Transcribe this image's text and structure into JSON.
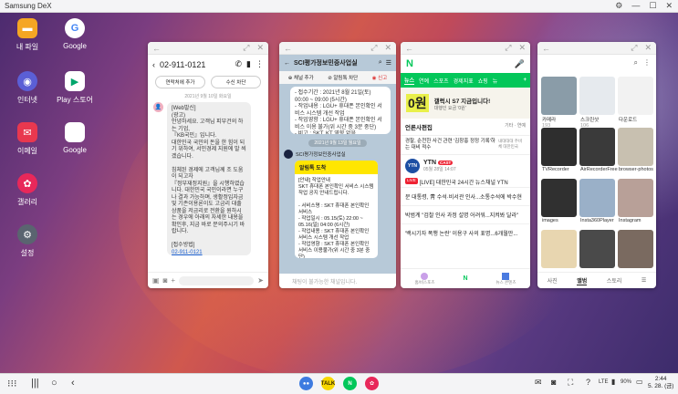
{
  "window_title": "Samsung DeX",
  "desktop_icons": [
    {
      "label": "내 파일",
      "icon": "folder-icon",
      "color": "#f5a623"
    },
    {
      "label": "Google",
      "icon": "google-icon",
      "color": "#ffffff"
    },
    {
      "label": "인터넷",
      "icon": "internet-icon",
      "color": "#5b5fd6"
    },
    {
      "label": "Play 스토어",
      "icon": "play-store-icon",
      "color": "#ffffff"
    },
    {
      "label": "이메일",
      "icon": "email-icon",
      "color": "#e8384f"
    },
    {
      "label": "Google",
      "icon": "google-apps-folder-icon",
      "color": "#ffffff"
    },
    {
      "label": "갤러리",
      "icon": "gallery-icon",
      "color": "#e8285a"
    },
    {
      "label": "설정",
      "icon": "settings-icon",
      "color": "#5a6470"
    }
  ],
  "messages": {
    "phone": "02-911-0121",
    "add_contact": "연락처에 추가",
    "block": "수신 차단",
    "date": "2021년 9월 10일 화요일",
    "sender_tag": "[Web발신]",
    "body": "(광고)\n안녕하세요. 고객님 피부건의 하는 기업,\n『KB국민』입니다.\n대한민국 국민의 돈을 한 힘이 되기 위하여, 서민경제 지원에 발 씌겠습니다.\n\n침체된 경제에 고객님께 조 도움이 되고자\n『정부재정지원』을 시행하였습니다. 대한민국 국민이라면 누구나 결과 가능하며, 생활정입자금 및 기존이용론이도 고금리 대출상품을 저금리로 전환을 원하시는 경우에 아래의 자세한 내용을 확인후, 지금 바로 문의주시기 바랍니다.\n\n[접수방법]",
    "link": "02-911-0121"
  },
  "kakao": {
    "title": "SCI평가정보민중사업실",
    "ch_add": "채널 추가",
    "alarm": "알림톡 차단",
    "report": "신고",
    "date_divider": "2021년 9월 13일 월요일",
    "msg1": "- 접수기간 : 2021년 8월 21일(토) 00:00 ~ 09:00 (5시간)\n- 작업내용 : LGU+ 휴대폰 본인확인 서비스 시스템 개선 작업\n- 작업영향 : LGU+ 휴대폰 본인확인 서비스 이용 불가(위 시간 중 3분 중단)\n- 비고 : SKT, KT 영향 없음",
    "sender": "SCI평가정보민중사업실",
    "card_header": "알림톡 도착",
    "card_body": "[안내] 작업안내\nSKT 휴대폰 본인확인 서비스 시스템 작업 공지 안내드립니다.\n\n- 서비스명 : SKT 휴대폰 본인확인 서비스\n- 작업일시 : 05.15(토) 22:00 ~ 05.16(일) 04:00 (6시간)\n- 작업내용 : SKT 휴대폰 본인확인 서비스 시스템 개선 작업\n- 작업영향 : SKT 휴대폰 본인확인 서비스 이용불가(위 시간 중 3분 중단)\n- 비고 : KT, LGU+ 영향 없음",
    "input_placeholder": "채팅이 불가능한 채널입니다."
  },
  "naver": {
    "tabs": [
      "뉴스",
      "연예",
      "스포츠",
      "경제지표",
      "쇼핑",
      "뉴"
    ],
    "banner_title": "갤럭시 S7 지금입니다!",
    "banner_sub": "대행인 요금 '0원'",
    "banner_big": "0원",
    "section": "언론사편집",
    "section_right": "기타 · 연예",
    "headline": "경찰, 순천한 사건 관련 '김창홍 정정 기록'하는 대비 적수",
    "headline_sub": "내대대대 주비체 대한민국",
    "press": "YTN",
    "press_badge": "CAST",
    "press_time": "05월 28일 14:07",
    "live_title": "[LIVE] 대한민국 24시간 뉴스채널 YTN",
    "lines": [
      "문 대통령, 靑 수석·비서관 인사...소통수석에 박수현",
      "박범계 \"검찰 인사 과정 설명 어려워...지켜봐 달라\"",
      "'백시기자 폭행 논란' 이용구 사의 표명...6개월만..."
    ],
    "bottom_tabs": [
      "홈/비스포츠",
      "N",
      "뉴스 콘텐츠"
    ]
  },
  "gallery": {
    "tiles": [
      {
        "label": "카메라",
        "count": "193",
        "color": "#8a9ca8"
      },
      {
        "label": "스크린샷",
        "count": "106",
        "color": "#e6eaee"
      },
      {
        "label": "다운로드",
        "count": "",
        "color": "#f2f2f2"
      },
      {
        "label": "TVRecorder",
        "count": "",
        "color": "#2e2e2e"
      },
      {
        "label": "AirRecorderFree",
        "count": "",
        "color": "#3a3a3a"
      },
      {
        "label": "browser-photos",
        "count": "",
        "color": "#c8c0b0"
      },
      {
        "label": "images",
        "count": "",
        "color": "#303030"
      },
      {
        "label": "Insta360Player",
        "count": "",
        "color": "#9ab0c8"
      },
      {
        "label": "Instagram",
        "count": "",
        "color": "#b8a098"
      },
      {
        "label": "",
        "count": "",
        "color": "#e8d6b0"
      },
      {
        "label": "",
        "count": "",
        "color": "#4a4a4a"
      },
      {
        "label": "",
        "count": "",
        "color": "#7a6a60"
      }
    ],
    "bottom_tabs": [
      "사진",
      "앨범",
      "스토리"
    ]
  },
  "taskbar": {
    "time": "2:44",
    "date": "5. 28. (금)",
    "battery": "90%",
    "network": "LTE",
    "app_icons": [
      {
        "icon": "messages-icon",
        "color": "#3d7be0",
        "glyph": "●●"
      },
      {
        "icon": "kakaotalk-icon",
        "color": "#f7d700",
        "glyph": "TALK"
      },
      {
        "icon": "naver-icon",
        "color": "#03c75a",
        "glyph": "N"
      },
      {
        "icon": "gallery-icon",
        "color": "#e8285a",
        "glyph": "✿"
      }
    ]
  }
}
